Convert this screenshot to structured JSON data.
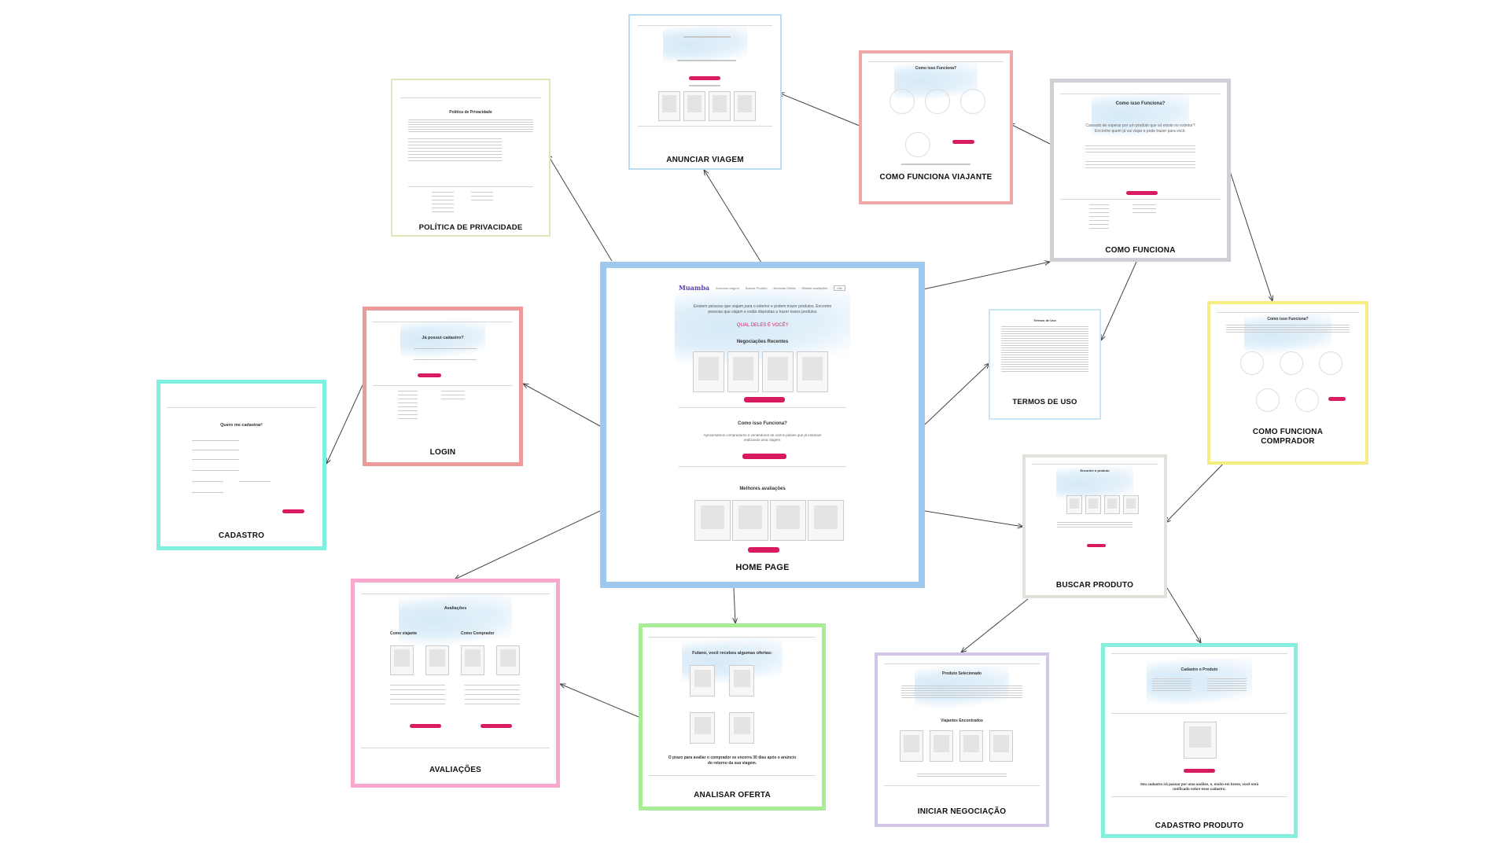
{
  "diagram": {
    "nodes": [
      {
        "id": "home",
        "title": "HOME PAGE",
        "color": "#9ec8ee"
      },
      {
        "id": "anunciar",
        "title": "ANUNCIAR VIAGEM",
        "color": "#b9dcf0"
      },
      {
        "id": "politica",
        "title": "POLÍTICA DE PRIVACIDADE",
        "color": "#dfe6b8"
      },
      {
        "id": "cf_viajante",
        "title": "COMO FUNCIONA VIAJANTE",
        "color": "#f0a8a8"
      },
      {
        "id": "como_funciona",
        "title": "COMO FUNCIONA",
        "color": "#cfcfd6"
      },
      {
        "id": "termos",
        "title": "TERMOS DE USO",
        "color": "#c8e6f4"
      },
      {
        "id": "cf_comprador",
        "title": "COMO FUNCIONA COMPRADOR",
        "color": "#f5ec82"
      },
      {
        "id": "login",
        "title": "LOGIN",
        "color": "#ef9a9a"
      },
      {
        "id": "cadastro",
        "title": "CADASTRO",
        "color": "#7ff0e0"
      },
      {
        "id": "avaliacoes",
        "title": "AVALIAÇÕES",
        "color": "#f7a8cc"
      },
      {
        "id": "analisar",
        "title": "ANALISAR OFERTA",
        "color": "#a8ec96"
      },
      {
        "id": "buscar",
        "title": "BUSCAR PRODUTO",
        "color": "#e2e2dc"
      },
      {
        "id": "iniciar",
        "title": "INICIAR NEGOCIAÇÃO",
        "color": "#d3c6e6"
      },
      {
        "id": "cad_produto",
        "title": "CADASTRO PRODUTO",
        "color": "#86f0df"
      }
    ],
    "edges": [
      [
        "home",
        "anunciar"
      ],
      [
        "home",
        "politica"
      ],
      [
        "home",
        "como_funciona"
      ],
      [
        "home",
        "termos"
      ],
      [
        "home",
        "login"
      ],
      [
        "home",
        "avaliacoes"
      ],
      [
        "home",
        "analisar"
      ],
      [
        "home",
        "buscar"
      ],
      [
        "login",
        "cadastro"
      ],
      [
        "cf_viajante",
        "anunciar"
      ],
      [
        "como_funciona",
        "cf_viajante"
      ],
      [
        "como_funciona",
        "termos"
      ],
      [
        "como_funciona",
        "cf_comprador"
      ],
      [
        "cf_comprador",
        "buscar"
      ],
      [
        "buscar",
        "iniciar"
      ],
      [
        "buscar",
        "cad_produto"
      ],
      [
        "analisar",
        "avaliacoes"
      ]
    ]
  },
  "home": {
    "brand": "Muamba",
    "nav": [
      "Anunciar viagem",
      "Buscar Produto",
      "Anunciar Oferta",
      "Minhas avaliações"
    ],
    "login_btn": "Olá",
    "hero_text": "Existem pessoas que viajam para o exterior e podem trazer produtos. Encontre pessoas que viajam e estão dispostas a trazer esses produtos",
    "hero_highlight": "QUAL DELES É VOCÊ?",
    "section_recent": "Negociações Recentes",
    "section_how": "Como isso Funciona?",
    "how_text": "Aproximamos compradores e vendedores de outros países que já estariam realizando uma viagem.",
    "section_reviews": "Melhores avaliações",
    "btn_buscar": "Buscar Produto",
    "btn_saiba": "Saiba como funciona",
    "btn_ver": "Ver mais"
  },
  "mini": {
    "politica_heading": "Política de Privacidade",
    "cf_heading": "Como isso Funciona?",
    "como_funciona_text": "Cansado de esperar por um produto que só existe no exterior? Encontre quem já vai viajar e pode trazer para você.",
    "termos_heading": "Termos de Uso",
    "login_heading": "Já possui cadastro?",
    "cadastro_heading": "Quero me cadastrar!",
    "avaliacoes_heading": "Avaliações",
    "av_col1": "Como viajante",
    "av_col2": "Como Comprador",
    "oferta_heading": "Fulano, você recebeu algumas ofertas:",
    "oferta_footer": "O prazo para avaliar o comprador se encerra 30 dias após o anúncio do retorno da sua viagem.",
    "buscar_heading": "Encontre o produto",
    "iniciar_heading": "Produto Selecionado",
    "iniciar_sub": "Viajantes Encontrados",
    "cad_produto_heading": "Cadastro o Produto",
    "cad_produto_footer": "Seu cadastro irá passar por uma análise, e, muito em breve, você será notificado sobre esse cadastro."
  }
}
